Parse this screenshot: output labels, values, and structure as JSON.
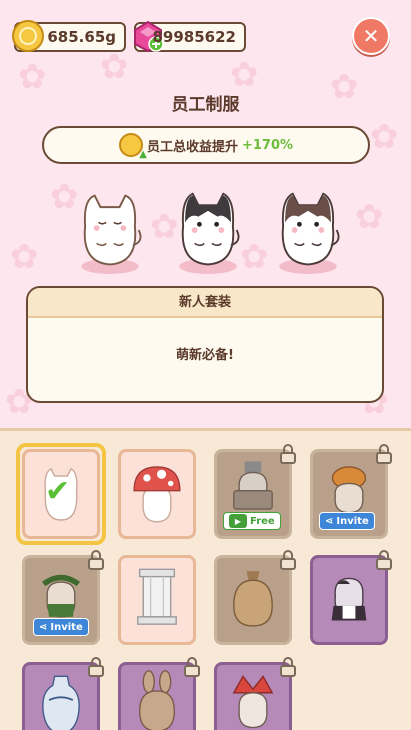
{
  "currency": {
    "coins": "685.65g",
    "gems": "89985622"
  },
  "title": "员工制服",
  "bonus": {
    "label": "员工总收益提升",
    "value": "+170%"
  },
  "outfit": {
    "name": "新人套装",
    "description": "萌新必备!"
  },
  "cards": [
    {
      "name": "newbie-cat",
      "state": "selected"
    },
    {
      "name": "mushroom-cat",
      "state": "owned"
    },
    {
      "name": "cart-cat",
      "state": "locked",
      "action": "Free"
    },
    {
      "name": "pumpkin-cat",
      "state": "locked",
      "action": "Invite"
    },
    {
      "name": "wreath-cat",
      "state": "locked",
      "action": "Invite"
    },
    {
      "name": "pillar-cat",
      "state": "owned"
    },
    {
      "name": "sack-cat",
      "state": "locked"
    },
    {
      "name": "maid-cat",
      "state": "locked"
    },
    {
      "name": "vase-cat",
      "state": "locked"
    },
    {
      "name": "bunny-cat",
      "state": "locked"
    },
    {
      "name": "jester-cat",
      "state": "locked"
    }
  ],
  "colors": {
    "accent_gold": "#f4c542",
    "close_red": "#f07965",
    "bonus_green": "#6cbd3a",
    "invite_blue": "#3e86d8"
  }
}
